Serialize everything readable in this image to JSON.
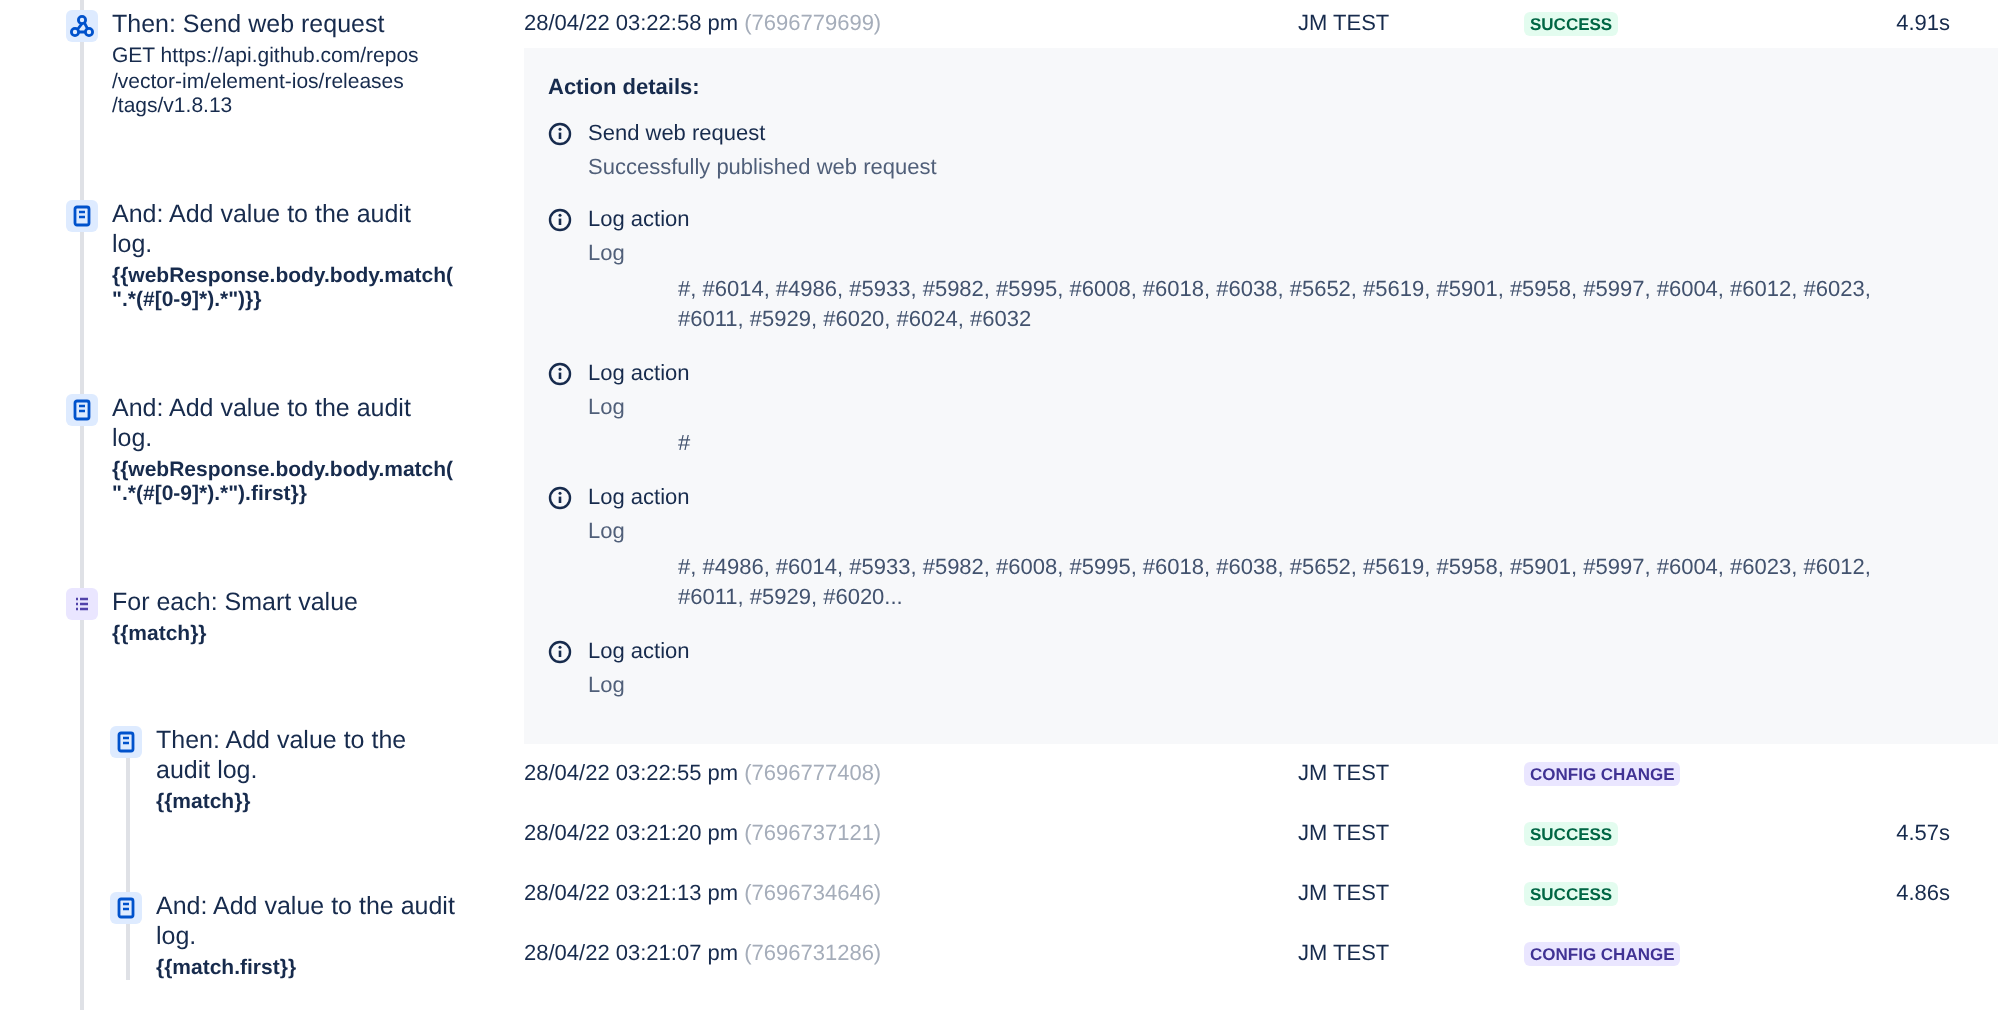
{
  "rule_components": [
    {
      "kind": "webhook",
      "title": "Then: Send web request",
      "detail": "GET https://api.github.com/repos\n/vector-im/element-ios/releases\n/tags/v1.8.13",
      "detail_bold": false
    },
    {
      "kind": "audit",
      "title": "And: Add value to the audit log.",
      "detail": "{{webResponse.body.body.match(\n\".*(#[0-9]*).*\")}}",
      "detail_bold": true
    },
    {
      "kind": "audit",
      "title": "And: Add value to the audit log.",
      "detail": "{{webResponse.body.body.match(\n\".*(#[0-9]*).*\").first}}",
      "detail_bold": true
    },
    {
      "kind": "branch",
      "title": "For each: Smart value",
      "detail": "{{match}}",
      "detail_bold": true,
      "children": [
        {
          "kind": "audit",
          "title": "Then: Add value to the audit log.",
          "detail": "{{match}}",
          "detail_bold": true
        },
        {
          "kind": "audit",
          "title": "And: Add value to the audit log.",
          "detail": "{{match.first}}",
          "detail_bold": true
        }
      ]
    }
  ],
  "audit_rows": [
    {
      "date": "28/04/22 03:22:58 pm",
      "id": "(7696779699)",
      "actor": "JM TEST",
      "status": "SUCCESS",
      "kind": "success",
      "duration": "4.91s",
      "details": {
        "heading": "Action details:",
        "actions": [
          {
            "title": "Send web request",
            "subtitle": "Successfully published web request"
          },
          {
            "title": "Log action",
            "subtitle": "Log",
            "message": "#, #6014, #4986, #5933, #5982, #5995, #6008, #6018, #6038, #5652, #5619, #5901, #5958, #5997, #6004, #6012, #6023, #6011, #5929, #6020, #6024, #6032"
          },
          {
            "title": "Log action",
            "subtitle": "Log",
            "message": "#"
          },
          {
            "title": "Log action",
            "subtitle": "Log",
            "message": "#, #4986, #6014, #5933, #5982, #6008, #5995, #6018, #6038, #5652, #5619, #5958, #5901, #5997, #6004, #6023, #6012, #6011, #5929, #6020..."
          },
          {
            "title": "Log action",
            "subtitle": "Log"
          }
        ]
      }
    },
    {
      "date": "28/04/22 03:22:55 pm",
      "id": "(7696777408)",
      "actor": "JM TEST",
      "status": "CONFIG CHANGE",
      "kind": "config"
    },
    {
      "date": "28/04/22 03:21:20 pm",
      "id": "(7696737121)",
      "actor": "JM TEST",
      "status": "SUCCESS",
      "kind": "success",
      "duration": "4.57s"
    },
    {
      "date": "28/04/22 03:21:13 pm",
      "id": "(7696734646)",
      "actor": "JM TEST",
      "status": "SUCCESS",
      "kind": "success",
      "duration": "4.86s"
    },
    {
      "date": "28/04/22 03:21:07 pm",
      "id": "(7696731286)",
      "actor": "JM TEST",
      "status": "CONFIG CHANGE",
      "kind": "config"
    }
  ]
}
